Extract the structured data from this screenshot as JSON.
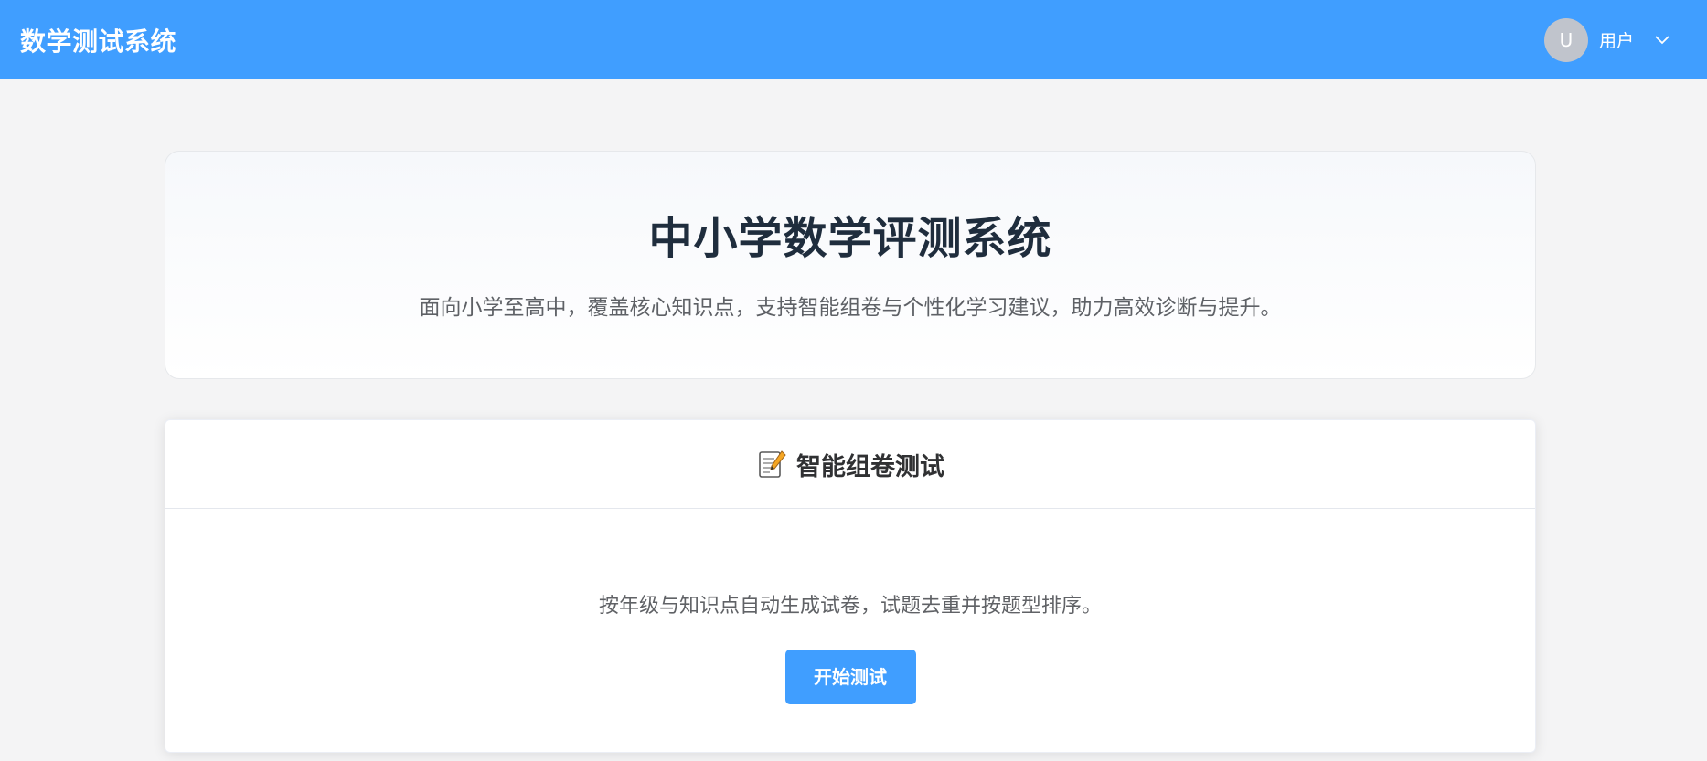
{
  "header": {
    "app_title": "数学测试系统",
    "user": {
      "avatar_letter": "U",
      "name": "用户",
      "dropdown_icon": "chevron-down-icon"
    }
  },
  "hero": {
    "title": "中小学数学评测系统",
    "subtitle": "面向小学至高中，覆盖核心知识点，支持智能组卷与个性化学习建议，助力高效诊断与提升。"
  },
  "test_card": {
    "icon": "memo-icon",
    "title": "智能组卷测试",
    "description": "按年级与知识点自动生成试卷，试题去重并按题型排序。",
    "start_button_label": "开始测试"
  },
  "colors": {
    "primary": "#409eff",
    "page_background": "#f4f4f5",
    "avatar_background": "#c0c4cc"
  }
}
